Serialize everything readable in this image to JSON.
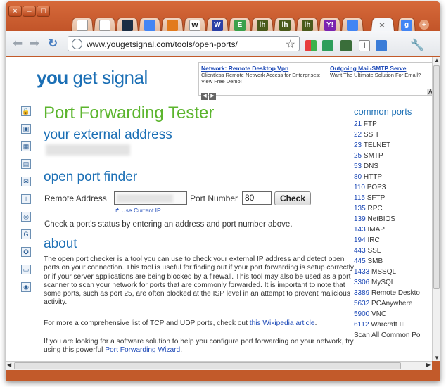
{
  "browser": {
    "url": "www.yougetsignal.com/tools/open-ports/",
    "window_controls": [
      "×",
      "–",
      "□"
    ],
    "colors": {
      "frame": "#c25a2a",
      "accent": "#1b6fb5",
      "heading": "#5cb52e"
    },
    "tabs": [
      {
        "icon": "blank-page-icon",
        "color": "#ffffff"
      },
      {
        "icon": "blank-page-icon",
        "color": "#ffffff"
      },
      {
        "icon": "steam-icon",
        "color": "#1c2e44"
      },
      {
        "icon": "google-icon",
        "color": "#4285f4"
      },
      {
        "icon": "hand-icon",
        "color": "#e27a1c"
      },
      {
        "icon": "wikipedia-icon",
        "color": "#ffffff",
        "glyph": "W"
      },
      {
        "icon": "w-icon",
        "color": "#2b3fa5",
        "glyph": "W"
      },
      {
        "icon": "e-icon",
        "color": "#3aa04b",
        "glyph": "E"
      },
      {
        "icon": "lh-icon",
        "color": "#4a5a1b",
        "glyph": "lh"
      },
      {
        "icon": "lh-icon",
        "color": "#4a5a1b",
        "glyph": "lh"
      },
      {
        "icon": "lh-icon",
        "color": "#4a5a1b",
        "glyph": "lh"
      },
      {
        "icon": "yahoo-icon",
        "color": "#7b22b0",
        "glyph": "Y!"
      },
      {
        "icon": "google-icon",
        "color": "#4285f4"
      }
    ]
  },
  "page": {
    "logo": {
      "part1": "you",
      "part2": " get signal"
    },
    "ad": {
      "col1_title": "Network: Remote Desktop Vpn",
      "col1_text": "Clientless Remote Network Access for Enterprises; View Free Demo!",
      "col2_title": "Outgoing Mail-SMTP Serve",
      "col2_text": "Want The Ultimate Solution For Email?",
      "badge": "Ad"
    },
    "title": "Port Forwarding Tester",
    "external_heading": "your external address",
    "finder_heading": "open port finder",
    "remote_label": "Remote Address",
    "port_label": "Port Number",
    "port_value": "80",
    "check_label": "Check",
    "use_current_ip": "Use Current IP",
    "instruction": "Check a port's status by entering an address and port number above.",
    "about_heading": "about",
    "about_p1": "The open port checker is a tool you can use to check your external IP address and detect open ports on your connection. This tool is useful for finding out if your port forwarding is setup correctly or if your server applications are being blocked by a firewall. This tool may also be used as a port scanner to scan your network for ports that are commonly forwarded. It is important to note that some ports, such as port 25, are often blocked at the ISP level in an attempt to prevent malicious activity.",
    "about_p2_pre": "For more a comprehensive list of TCP and UDP ports, check out ",
    "about_p2_link": "this Wikipedia article",
    "about_p2_post": ".",
    "about_p3_pre": "If you are looking for a software solution to help you configure port forwarding on your network, try using this powerful ",
    "about_p3_link": "Port Forwarding Wizard",
    "about_p3_post": ".",
    "common_ports_title": "common ports",
    "ports": [
      {
        "num": "21",
        "name": " FTP"
      },
      {
        "num": "22",
        "name": " SSH"
      },
      {
        "num": "23",
        "name": " TELNET"
      },
      {
        "num": "25",
        "name": " SMTP"
      },
      {
        "num": "53",
        "name": " DNS"
      },
      {
        "num": "80",
        "name": " HTTP"
      },
      {
        "num": "110",
        "name": " POP3"
      },
      {
        "num": "115",
        "name": " SFTP"
      },
      {
        "num": "135",
        "name": " RPC"
      },
      {
        "num": "139",
        "name": " NetBIOS"
      },
      {
        "num": "143",
        "name": " IMAP"
      },
      {
        "num": "194",
        "name": " IRC"
      },
      {
        "num": "443",
        "name": " SSL"
      },
      {
        "num": "445",
        "name": " SMB"
      },
      {
        "num": "1433",
        "name": " MSSQL"
      },
      {
        "num": "3306",
        "name": " MySQL"
      },
      {
        "num": "3389",
        "name": " Remote Deskto"
      },
      {
        "num": "5632",
        "name": " PCAnywhere"
      },
      {
        "num": "5900",
        "name": " VNC"
      },
      {
        "num": "6112",
        "name": " Warcraft III"
      },
      {
        "num": "",
        "name": "Scan All Common Po"
      }
    ]
  }
}
